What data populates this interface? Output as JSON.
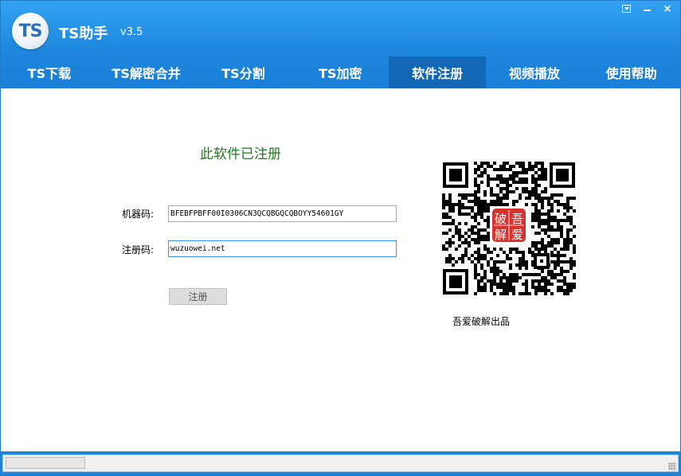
{
  "app": {
    "logo_text": "TS",
    "title": "TS助手",
    "version": "v3.5"
  },
  "window_controls": {
    "menu_icon": "dropdown-menu-icon",
    "minimize_icon": "minimize-icon",
    "close_glyph": "×"
  },
  "nav": {
    "tabs": [
      {
        "label": "TS下载"
      },
      {
        "label": "TS解密合并"
      },
      {
        "label": "TS分割"
      },
      {
        "label": "TS加密"
      },
      {
        "label": "软件注册",
        "active": true
      },
      {
        "label": "视频播放"
      },
      {
        "label": "使用帮助"
      }
    ]
  },
  "registration": {
    "status": "此软件已注册",
    "machine_code_label": "机器码:",
    "machine_code_value": "BFEBFPBFF00I0306CN3QCQBGQCQBOYY54601GY",
    "reg_code_label": "注册码:",
    "reg_code_value": "wuzuowei.net",
    "register_button": "注册"
  },
  "qr": {
    "overlay_text": [
      "破",
      "吾",
      "解",
      "爱"
    ],
    "caption": "吾爱破解出品"
  },
  "colors": {
    "header_blue": "#1d86dd",
    "active_tab": "#1368b5",
    "status_green": "#1e7d1e",
    "qr_badge_red": "#d8322e"
  }
}
